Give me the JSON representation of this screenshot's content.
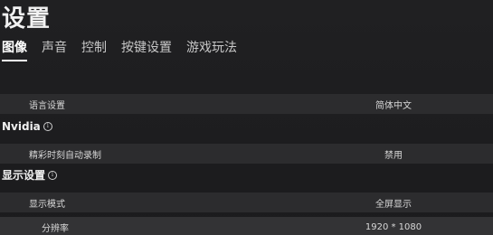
{
  "header": {
    "title": "设置"
  },
  "tabs": [
    {
      "label": "图像"
    },
    {
      "label": "声音"
    },
    {
      "label": "控制"
    },
    {
      "label": "按键设置"
    },
    {
      "label": "游戏玩法"
    }
  ],
  "language": {
    "label": "语言设置",
    "value": "简体中文"
  },
  "nvidia": {
    "section_title": "Nvidia",
    "highlight_label": "精彩时刻自动录制",
    "highlight_value": "禁用"
  },
  "display": {
    "section_title": "显示设置",
    "mode_label": "显示模式",
    "mode_value": "全屏显示",
    "resolution_label": "分辨率",
    "resolution_value": "1920 * 1080"
  },
  "icons": {
    "info": "info-icon"
  }
}
